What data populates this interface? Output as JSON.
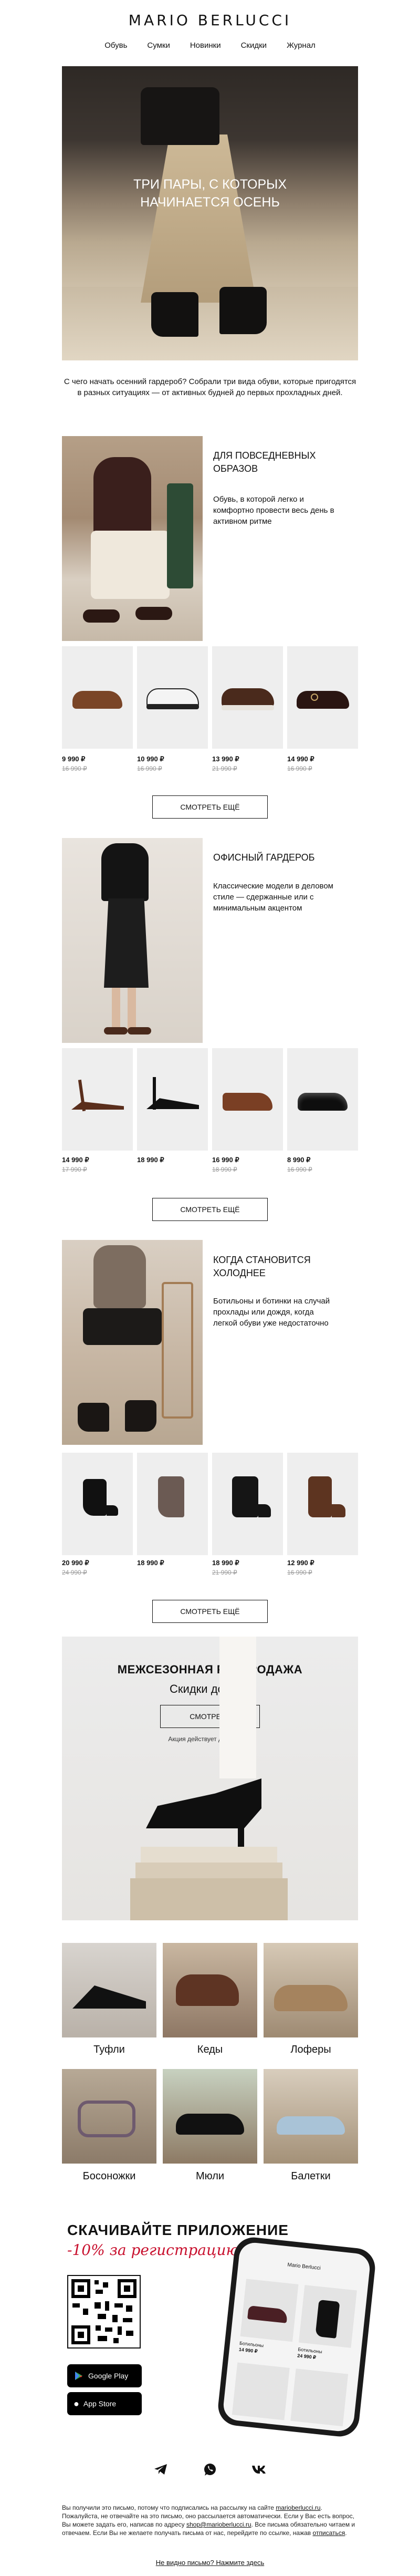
{
  "brand": {
    "logo": "MARIO BERLUCCI"
  },
  "nav": [
    "Обувь",
    "Сумки",
    "Новинки",
    "Скидки",
    "Журнал"
  ],
  "hero": {
    "title_line1": "ТРИ ПАРЫ, С КОТОРЫХ",
    "title_line2": "НАЧИНАЕТСЯ ОСЕНЬ"
  },
  "intro": "С чего начать осенний гардероб? Собрали три вида обуви, которые пригодятся в разных ситуациях — от активных будней до первых прохладных дней.",
  "sections": [
    {
      "title": "ДЛЯ ПОВСЕДНЕВНЫХ ОБРАЗОВ",
      "text": "Обувь, в которой легко и комфортно провести весь день в активном ритме",
      "products": [
        {
          "price": "9 990 ₽",
          "old": "16 990 ₽",
          "icon": "loafer-brown"
        },
        {
          "price": "10 990 ₽",
          "old": "16 990 ₽",
          "icon": "sneaker-white"
        },
        {
          "price": "13 990 ₽",
          "old": "21 990 ₽",
          "icon": "sneaker-brown"
        },
        {
          "price": "14 990 ₽",
          "old": "16 990 ₽",
          "icon": "loafer-black"
        }
      ],
      "button": "СМОТРЕТЬ ЕЩЁ"
    },
    {
      "title": "ОФИСНЫЙ ГАРДЕРОБ",
      "text": "Классические модели в деловом стиле — сдержанные или с минимальным акцентом",
      "products": [
        {
          "price": "14 990 ₽",
          "old": "17 990 ₽",
          "icon": "pump-brown"
        },
        {
          "price": "18 990 ₽",
          "old": "",
          "icon": "mary-jane-black"
        },
        {
          "price": "16 990 ₽",
          "old": "18 990 ₽",
          "icon": "loafer-heel-brown"
        },
        {
          "price": "8 990 ₽",
          "old": "16 990 ₽",
          "icon": "loafer-black-patent"
        }
      ],
      "button": "СМОТРЕТЬ ЕЩЁ"
    },
    {
      "title": "КОГДА СТАНОВИТСЯ ХОЛОДНЕЕ",
      "text": "Ботильоны и ботинки на случай прохлады или дождя, когда легкой обуви уже недостаточно",
      "products": [
        {
          "price": "20 990 ₽",
          "old": "24 990 ₽",
          "icon": "ankle-boot-black"
        },
        {
          "price": "18 990 ₽",
          "old": "",
          "icon": "ankle-boot-grey"
        },
        {
          "price": "18 990 ₽",
          "old": "21 990 ₽",
          "icon": "lace-boot-black"
        },
        {
          "price": "12 990 ₽",
          "old": "16 990 ₽",
          "icon": "chelsea-brown"
        }
      ],
      "button": "СМОТРЕТЬ ЕЩЁ"
    }
  ],
  "sale": {
    "title": "МЕЖСЕЗОННАЯ РАСПРОДАЖА",
    "subtitle": "Скидки до 60%",
    "button": "СМОТРЕТЬ",
    "note": "Акция действует до 25.09.25"
  },
  "categories": [
    "Туфли",
    "Кеды",
    "Лоферы",
    "Босоножки",
    "Мюли",
    "Балетки"
  ],
  "app": {
    "title": "СКАЧИВАЙТЕ ПРИЛОЖЕНИЕ",
    "subtitle": "-10% за регистрацию",
    "google": "Google Play",
    "apple": "App Store",
    "phone_brand": "Mario Berlucci",
    "phone_item1": "Ботильоны",
    "phone_item2": "Ботильоны",
    "phone_price1": "14 990 ₽",
    "phone_price2": "24 990 ₽"
  },
  "social": [
    "telegram-icon",
    "whatsapp-icon",
    "vk-icon"
  ],
  "footer": {
    "line1": "Вы получили это письмо, потому что подписались на рассылку на сайте",
    "link1": "marioberlucci.ru",
    "line2": "Пожалуйста, не отвечайте на это письмо, оно рассылается автоматически. Если у Вас есть вопрос, Вы можете задать его, написав по адресу",
    "link2": "shop@marioberlucci.ru",
    "line3": ". Все письма обязательно читаем и отвечаем. Если Вы не желаете получать письма от нас, перейдите по ссылке, нажав",
    "link3": "отписаться",
    "unsubscribe": "Не видно письмо? Нажмите здесь"
  },
  "colors": {
    "accent_red": "#c8102e",
    "text": "#111111",
    "muted": "#9a9a9a",
    "tile_bg": "#eeeeee"
  }
}
